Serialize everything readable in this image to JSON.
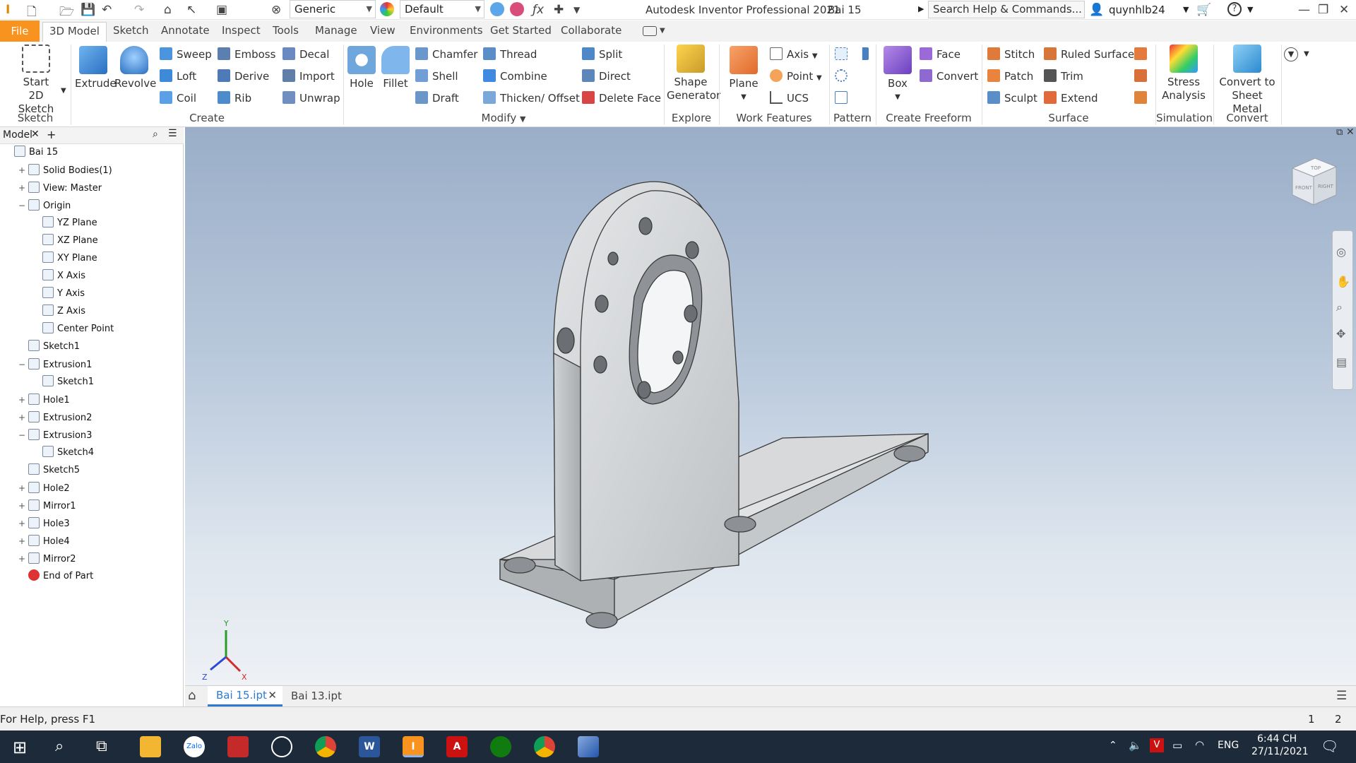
{
  "app": {
    "title": "Autodesk Inventor Professional 2021",
    "doc": "Bai 15",
    "search_placeholder": "Search Help & Commands...",
    "user": "quynhlb24",
    "material": "Generic",
    "appearance": "Default"
  },
  "tabs": [
    "File",
    "3D Model",
    "Sketch",
    "Annotate",
    "Inspect",
    "Tools",
    "Manage",
    "View",
    "Environments",
    "Get Started",
    "Collaborate"
  ],
  "ribbon": {
    "sketch": {
      "start_line1": "Start",
      "start_line2": "2D Sketch",
      "group": "Sketch"
    },
    "create": {
      "extrude": "Extrude",
      "revolve": "Revolve",
      "sweep": "Sweep",
      "emboss": "Emboss",
      "decal": "Decal",
      "loft": "Loft",
      "derive": "Derive",
      "import": "Import",
      "coil": "Coil",
      "rib": "Rib",
      "unwrap": "Unwrap",
      "group": "Create"
    },
    "modify": {
      "hole": "Hole",
      "fillet": "Fillet",
      "chamfer": "Chamfer",
      "thread": "Thread",
      "split": "Split",
      "shell": "Shell",
      "combine": "Combine",
      "direct": "Direct",
      "draft": "Draft",
      "thicken": "Thicken/ Offset",
      "delete_face": "Delete Face",
      "group": "Modify"
    },
    "explore": {
      "shape_line1": "Shape",
      "shape_line2": "Generator",
      "group": "Explore"
    },
    "work": {
      "plane": "Plane",
      "axis": "Axis",
      "point": "Point",
      "ucs": "UCS",
      "group": "Work Features"
    },
    "pattern": {
      "group": "Pattern"
    },
    "freeform": {
      "box": "Box",
      "face": "Face",
      "convert": "Convert",
      "group": "Create Freeform"
    },
    "surface": {
      "stitch": "Stitch",
      "ruled": "Ruled Surface",
      "patch": "Patch",
      "trim": "Trim",
      "sculpt": "Sculpt",
      "extend": "Extend",
      "group": "Surface"
    },
    "simulation": {
      "stress_line1": "Stress",
      "stress_line2": "Analysis",
      "group": "Simulation"
    },
    "convert": {
      "line1": "Convert to",
      "line2": "Sheet Metal",
      "group": "Convert"
    }
  },
  "browser": {
    "tab": "Model",
    "items": [
      {
        "label": "Bai 15",
        "ex": "",
        "indent": 0
      },
      {
        "label": "Solid Bodies(1)",
        "ex": "+",
        "indent": 1
      },
      {
        "label": "View: Master",
        "ex": "+",
        "indent": 1
      },
      {
        "label": "Origin",
        "ex": "−",
        "indent": 1
      },
      {
        "label": "YZ Plane",
        "ex": "",
        "indent": 2
      },
      {
        "label": "XZ Plane",
        "ex": "",
        "indent": 2
      },
      {
        "label": "XY Plane",
        "ex": "",
        "indent": 2
      },
      {
        "label": "X Axis",
        "ex": "",
        "indent": 2
      },
      {
        "label": "Y Axis",
        "ex": "",
        "indent": 2
      },
      {
        "label": "Z Axis",
        "ex": "",
        "indent": 2
      },
      {
        "label": "Center Point",
        "ex": "",
        "indent": 2
      },
      {
        "label": "Sketch1",
        "ex": "",
        "indent": 1
      },
      {
        "label": "Extrusion1",
        "ex": "−",
        "indent": 1
      },
      {
        "label": "Sketch1",
        "ex": "",
        "indent": 2
      },
      {
        "label": "Hole1",
        "ex": "+",
        "indent": 1
      },
      {
        "label": "Extrusion2",
        "ex": "+",
        "indent": 1
      },
      {
        "label": "Extrusion3",
        "ex": "−",
        "indent": 1
      },
      {
        "label": "Sketch4",
        "ex": "",
        "indent": 2
      },
      {
        "label": "Sketch5",
        "ex": "",
        "indent": 1
      },
      {
        "label": "Hole2",
        "ex": "+",
        "indent": 1
      },
      {
        "label": "Mirror1",
        "ex": "+",
        "indent": 1
      },
      {
        "label": "Hole3",
        "ex": "+",
        "indent": 1
      },
      {
        "label": "Hole4",
        "ex": "+",
        "indent": 1
      },
      {
        "label": "Mirror2",
        "ex": "+",
        "indent": 1
      },
      {
        "label": "End of Part",
        "ex": "",
        "indent": 1
      }
    ]
  },
  "viewcube": {
    "top": "TOP",
    "front": "FRONT",
    "right": "RIGHT"
  },
  "doctabs": [
    "Bai 15.ipt",
    "Bai 13.ipt"
  ],
  "status": {
    "help": "For Help, press F1",
    "n1": "1",
    "n2": "2"
  },
  "taskbar": {
    "lang": "ENG",
    "time": "6:44 CH",
    "date": "27/11/2021"
  },
  "colors": {
    "file_tab": "#f7931e",
    "accent_blue": "#2b7bd0"
  }
}
